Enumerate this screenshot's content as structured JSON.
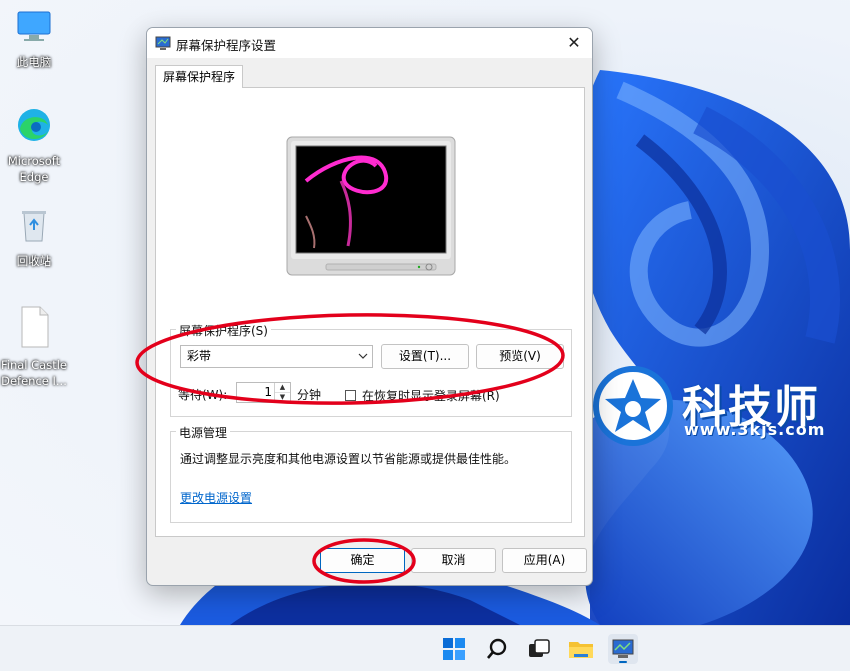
{
  "desktop": {
    "icons": [
      {
        "label": "此电脑",
        "icon": "computer-icon"
      },
      {
        "label": "Microsoft Edge",
        "icon": "edge-icon"
      },
      {
        "label": "回收站",
        "icon": "recycle-bin-icon"
      },
      {
        "label": "Final Castle Defence I...",
        "icon": "file-icon"
      }
    ],
    "watermark": {
      "brand": "科技师",
      "url": "www.3kjs.com"
    }
  },
  "dialog": {
    "title": "屏幕保护程序设置",
    "close_glyph": "✕",
    "tab_label": "屏幕保护程序",
    "screensaver_group": {
      "label": "屏幕保护程序(S)",
      "selected": "彩带",
      "settings_button": "设置(T)...",
      "preview_button": "预览(V)",
      "wait_label": "等待(W):",
      "wait_value": "1",
      "wait_unit": "分钟",
      "resume_label": "在恢复时显示登录屏幕(R)",
      "resume_checked": false
    },
    "power_group": {
      "label": "电源管理",
      "description": "通过调整显示亮度和其他电源设置以节省能源或提供最佳性能。",
      "link": "更改电源设置"
    },
    "buttons": {
      "ok": "确定",
      "cancel": "取消",
      "apply": "应用(A)"
    }
  },
  "colors": {
    "annotation": "#e3001b",
    "accent": "#0067c0",
    "link": "#0066cc"
  },
  "taskbar": {
    "icons": [
      "windows-start-icon",
      "search-icon",
      "task-view-icon",
      "file-explorer-icon",
      "screensaver-app-icon"
    ]
  }
}
